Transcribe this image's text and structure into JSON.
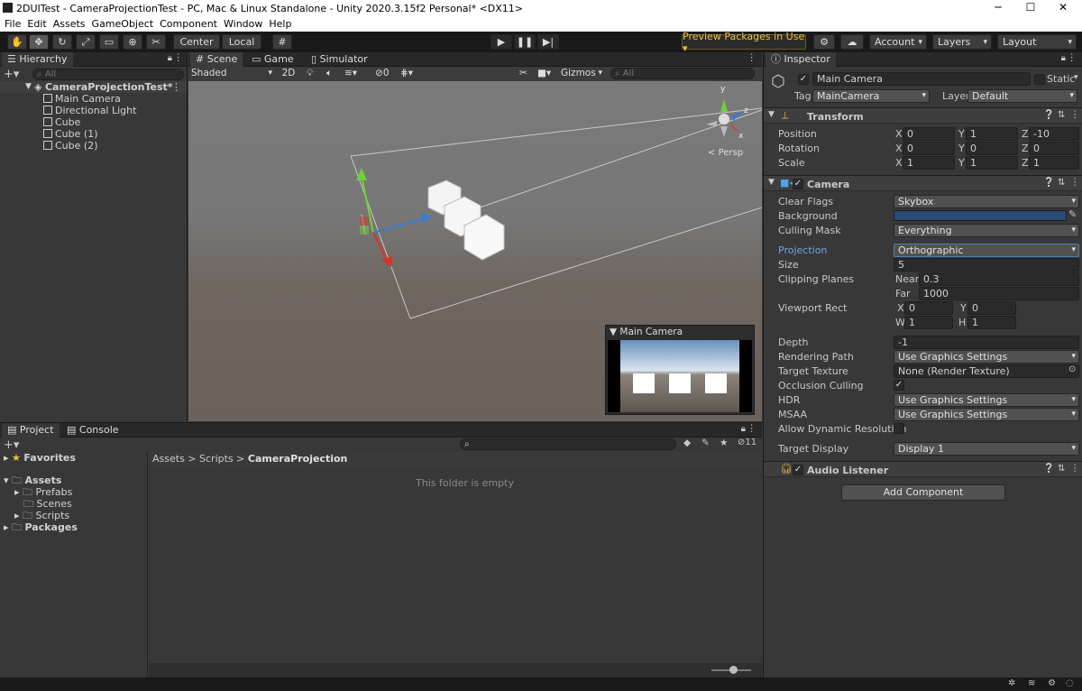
{
  "window": {
    "title": "2DUITest - CameraProjectionTest - PC, Mac & Linux Standalone - Unity 2020.3.15f2 Personal* <DX11>",
    "minimize": "─",
    "maximize": "☐",
    "close": "✕"
  },
  "menu": [
    "File",
    "Edit",
    "Assets",
    "GameObject",
    "Component",
    "Window",
    "Help"
  ],
  "toolbar": {
    "center_label": "Center",
    "local_label": "Local",
    "preview_packages": "Preview Packages in Use ▾",
    "account": "Account",
    "layers": "Layers",
    "layout": "Layout"
  },
  "hierarchy": {
    "tab": "Hierarchy",
    "search_placeholder": "All",
    "scene_name": "CameraProjectionTest*",
    "items": [
      "Main Camera",
      "Directional Light",
      "Cube",
      "Cube (1)",
      "Cube (2)"
    ]
  },
  "scene_view": {
    "tabs": [
      "Scene",
      "Game",
      "Simulator"
    ],
    "shading": "Shaded",
    "mode_2d": "2D",
    "hidden_count": "0",
    "gizmos": "Gizmos",
    "search_placeholder": "All",
    "persp": "Persp",
    "gizmo_axes": {
      "x": "x",
      "y": "y",
      "z": "z"
    },
    "camera_preview_title": "Main Camera"
  },
  "project": {
    "tabs": [
      "Project",
      "Console"
    ],
    "favorites": "Favorites",
    "assets": "Assets",
    "asset_folders": [
      "Prefabs",
      "Scenes",
      "Scripts"
    ],
    "packages": "Packages",
    "breadcrumb": [
      "Assets",
      "Scripts",
      "CameraProjection"
    ],
    "empty_message": "This folder is empty",
    "hidden_count": "11"
  },
  "inspector": {
    "tab": "Inspector",
    "object_name": "Main Camera",
    "static_label": "Static",
    "tag_label": "Tag",
    "tag_value": "MainCamera",
    "layer_label": "Layer",
    "layer_value": "Default",
    "transform": {
      "title": "Transform",
      "rows": [
        {
          "label": "Position",
          "x": "0",
          "y": "1",
          "z": "-10"
        },
        {
          "label": "Rotation",
          "x": "0",
          "y": "0",
          "z": "0"
        },
        {
          "label": "Scale",
          "x": "1",
          "y": "1",
          "z": "1"
        }
      ]
    },
    "camera": {
      "title": "Camera",
      "clear_flags_label": "Clear Flags",
      "clear_flags": "Skybox",
      "background_label": "Background",
      "background_color": "#2a4a78",
      "culling_mask_label": "Culling Mask",
      "culling_mask": "Everything",
      "projection_label": "Projection",
      "projection": "Orthographic",
      "size_label": "Size",
      "size": "5",
      "clipping_label": "Clipping Planes",
      "near_label": "Near",
      "near": "0.3",
      "far_label": "Far",
      "far": "1000",
      "viewport_label": "Viewport Rect",
      "vx": "0",
      "vy": "0",
      "vw": "1",
      "vh": "1",
      "depth_label": "Depth",
      "depth": "-1",
      "rendering_path_label": "Rendering Path",
      "rendering_path": "Use Graphics Settings",
      "target_texture_label": "Target Texture",
      "target_texture": "None (Render Texture)",
      "occlusion_label": "Occlusion Culling",
      "hdr_label": "HDR",
      "hdr": "Use Graphics Settings",
      "msaa_label": "MSAA",
      "msaa": "Use Graphics Settings",
      "dynres_label": "Allow Dynamic Resolution",
      "target_display_label": "Target Display",
      "target_display": "Display 1"
    },
    "audio_listener": "Audio Listener",
    "add_component": "Add Component"
  }
}
